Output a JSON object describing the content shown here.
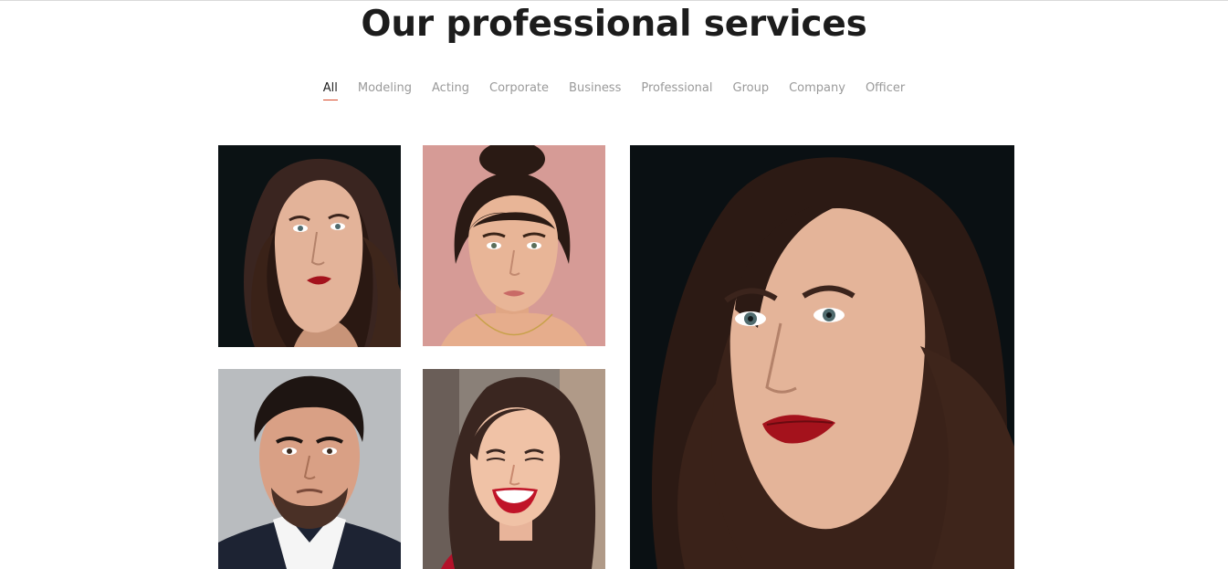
{
  "page": {
    "title": "Our professional services"
  },
  "filters": [
    {
      "label": "All"
    },
    {
      "label": "Modeling"
    },
    {
      "label": "Acting"
    },
    {
      "label": "Corporate"
    },
    {
      "label": "Business"
    },
    {
      "label": "Professional"
    },
    {
      "label": "Group"
    },
    {
      "label": "Company"
    },
    {
      "label": "Officer"
    }
  ],
  "active_filter": "All",
  "gallery": {
    "items": [
      {
        "subject": "woman with dark wavy hair and red lipstick, dark background"
      },
      {
        "subject": "woman with hair bun on pink background"
      },
      {
        "subject": "man with beard in dark blazer and white shirt, grey background"
      },
      {
        "subject": "smiling woman with red lipstick and red top"
      },
      {
        "subject": "woman with dark wavy hair and red lipstick, close-up, dark background"
      }
    ]
  },
  "colors": {
    "title": "#1c1c1c",
    "filter_inactive": "#9a9a9a",
    "filter_active": "#222222",
    "active_underline": "#d84a2a"
  }
}
